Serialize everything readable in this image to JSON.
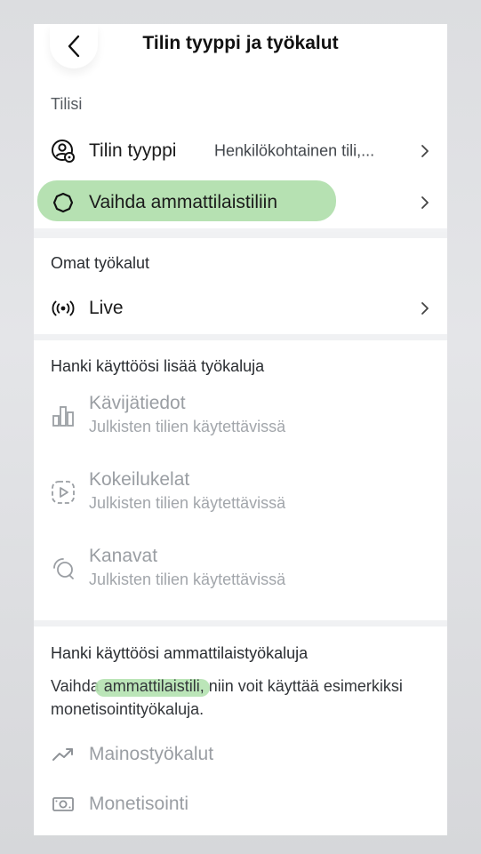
{
  "header": {
    "title": "Tilin tyyppi ja työkalut"
  },
  "account": {
    "section_title": "Tilisi",
    "type_label": "Tilin tyyppi",
    "type_value": "Henkilökohtainen tili,...",
    "switch_label": "Vaihda ammattilaistiliin"
  },
  "own_tools": {
    "section_title": "Omat työkalut",
    "live_label": "Live"
  },
  "more_tools": {
    "section_title": "Hanki käyttöösi lisää työkaluja",
    "items": [
      {
        "title": "Kävijätiedot",
        "subtitle": "Julkisten tilien käytettävissä",
        "icon": "bar-chart-icon"
      },
      {
        "title": "Kokeilukelat",
        "subtitle": "Julkisten tilien käytettävissä",
        "icon": "reel-trial-icon"
      },
      {
        "title": "Kanavat",
        "subtitle": "Julkisten tilien käytettävissä",
        "icon": "channel-icon"
      }
    ]
  },
  "pro_tools": {
    "section_title": "Hanki käyttöösi ammattilaistyökaluja",
    "desc_before": "Vaihda ",
    "desc_link": "ammattilaistili,",
    "desc_after": " niin voit käyttää esimerkiksi monetisointityökaluja.",
    "items": [
      {
        "label": "Mainostyökalut",
        "icon": "trending-up-icon"
      },
      {
        "label": "Monetisointi",
        "icon": "money-icon"
      }
    ]
  },
  "colors": {
    "highlight": "#a9dca4",
    "muted": "#9a9ea3"
  }
}
